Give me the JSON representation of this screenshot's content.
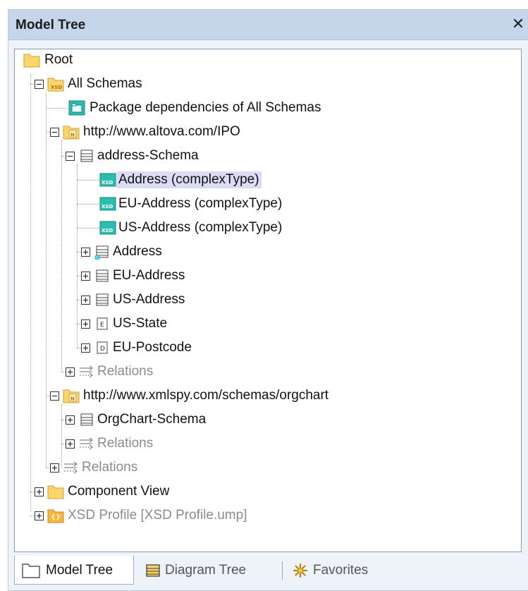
{
  "panel": {
    "title": "Model Tree",
    "close_glyph": "✕"
  },
  "tree": {
    "root": "Root",
    "all_schemas": "All Schemas",
    "package_dependencies": "Package dependencies of All Schemas",
    "ns_ipo": "http://www.altova.com/IPO",
    "address_schema": "address-Schema",
    "address_ct": "Address (complexType)",
    "eu_address_ct": "EU-Address (complexType)",
    "us_address_ct": "US-Address (complexType)",
    "address": "Address",
    "eu_address": "EU-Address",
    "us_address": "US-Address",
    "us_state": "US-State",
    "eu_postcode": "EU-Postcode",
    "relations_ipo": "Relations",
    "ns_orgchart": "http://www.xmlspy.com/schemas/orgchart",
    "orgchart_schema": "OrgChart-Schema",
    "relations_orgchart": "Relations",
    "relations_all": "Relations",
    "component_view": "Component View",
    "xsd_profile": "XSD Profile [XSD Profile.ump]",
    "xsd_badge": "XSD",
    "n_badge": "N",
    "e_badge": "E",
    "d_badge": "D"
  },
  "tabs": [
    {
      "label": "Model Tree",
      "icon": "folder-icon",
      "active": true
    },
    {
      "label": "Diagram Tree",
      "icon": "diagram-tree-icon",
      "active": false
    },
    {
      "label": "Favorites",
      "icon": "favorites-star-icon",
      "active": false
    }
  ],
  "colors": {
    "titlebar": "#c5d6ea",
    "selection": "#dcdcf6",
    "folder": "#fbd56a",
    "xsd_teal": "#2bbdb0"
  }
}
